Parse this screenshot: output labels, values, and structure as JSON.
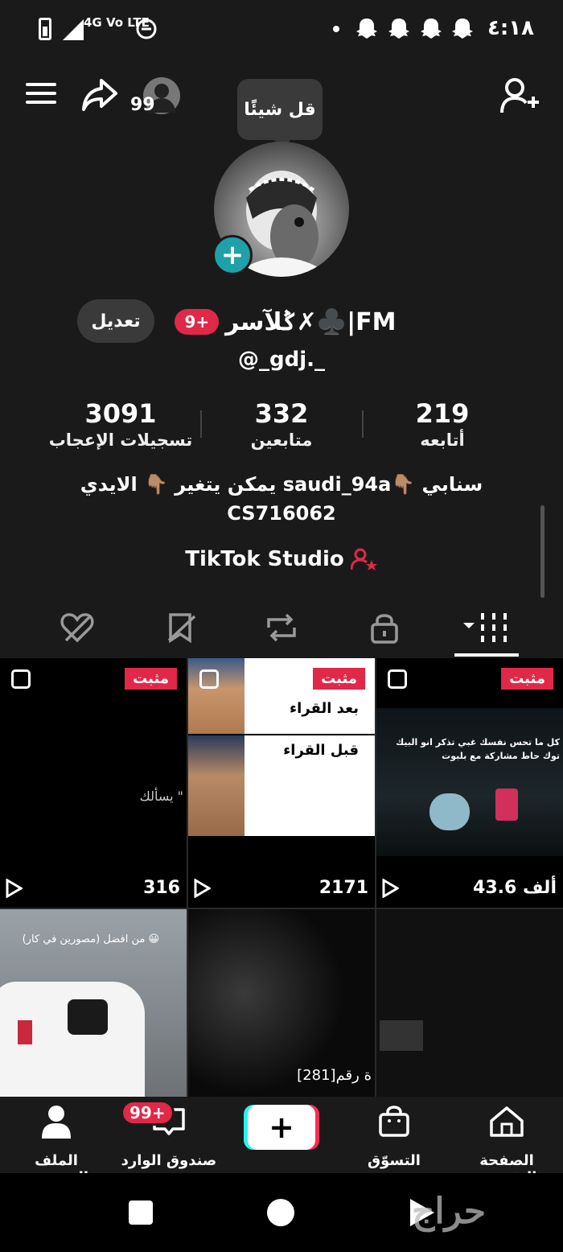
{
  "status_bar": {
    "network": "4G Vo LTE",
    "time": "٤:١٨"
  },
  "top_bar": {
    "views_count": "99",
    "tooltip": "قل شيئًا"
  },
  "profile": {
    "display_name": "ݣلآسر✗♣️|FM",
    "badge": "9+",
    "edit_label": "تعديل",
    "handle": "@_gdj._"
  },
  "stats": [
    {
      "value": "3091",
      "label": "تسجيلات الإعجاب"
    },
    {
      "value": "332",
      "label": "متابعين"
    },
    {
      "value": "219",
      "label": "أتابعه"
    }
  ],
  "bio": {
    "line1": "سنابي 👇🏽saudi_94a  يمكن يتغير 👇🏽 الايدي",
    "line2": "CS716062"
  },
  "studio_label": "TikTok Studio",
  "grid": {
    "pinned_label": "مثبت",
    "videos": [
      {
        "views": "43.6 ألف",
        "caption": "كل ما تحس نفسك غبي تذكر انو البيك توك حاط مشاركة مع بلبوت"
      },
      {
        "views": "2171",
        "caption_top": "بعد القراء",
        "caption_bottom": "قبل القراء"
      },
      {
        "views": "316",
        "caption": "يسألك \""
      },
      {
        "caption": "من افضل (مصورين في كار) 😀"
      },
      {
        "caption": "ة رقم[281]"
      }
    ]
  },
  "bottom_nav": {
    "home": "الصفحة الرئيسية",
    "shop": "التسوّق",
    "inbox": "صندوق الوارد",
    "inbox_badge": "99+",
    "profile": "الملف الشخصي"
  },
  "watermark": "حراج",
  "colors": {
    "accent_red": "#e02848",
    "teal": "#20a0a8",
    "background": "#1a1a1a"
  }
}
